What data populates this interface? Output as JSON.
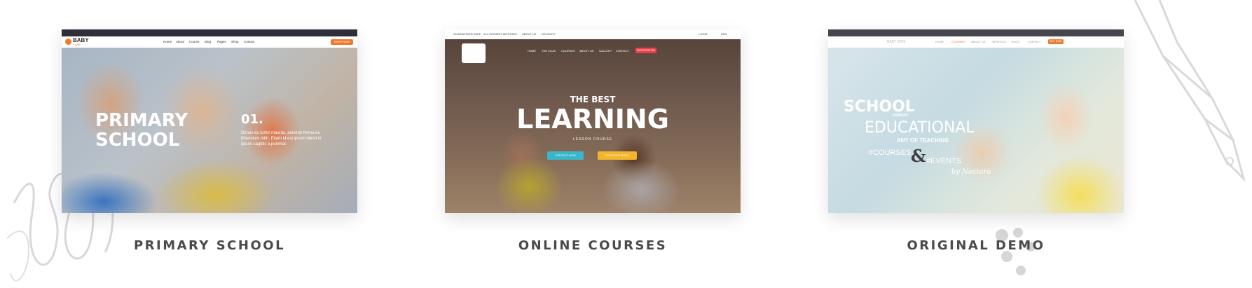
{
  "cards": [
    {
      "caption": "PRIMARY SCHOOL",
      "site": {
        "logo_line1": "BABY",
        "logo_line2": "CARE",
        "nav": [
          "Home",
          "About",
          "Course",
          "Blog",
          "Pages",
          "Shop",
          "Contact"
        ],
        "nav_button": "SHOP NOW",
        "hero_title_line1": "PRIMARY",
        "hero_title_line2": "SCHOOL",
        "hero_number": "01.",
        "hero_text": "Donec eu tortor maurus, pulvinar fermo eu bibendum nibh. Etiam id est ipsum blend in ipsum sagittis a pulvinar."
      }
    },
    {
      "caption": "ONLINE COURSES",
      "site": {
        "top_links": [
          "GUARANTEED SAFE",
          "ALL PAYMENT METHODS",
          "ABOUT US",
          "DELIVERY"
        ],
        "top_right": [
          "LOGIN",
          "ENG"
        ],
        "nav": [
          "HOME",
          "THE CLUB",
          "COURSES",
          "ABOUT US",
          "GALLERY",
          "CONTACT"
        ],
        "nav_button": "REGISTRATION",
        "hero_kicker": "THE BEST",
        "hero_title": "LEARNING",
        "hero_sub": "LESSON COURSE",
        "btn_primary": "CONTACT NOW",
        "btn_secondary": "DISCOVER MORE"
      }
    },
    {
      "caption": "ORIGINAL DEMO",
      "site": {
        "logo": "BABY KIDS",
        "nav": [
          "HOME",
          "COURSES",
          "ABOUT US",
          "SERVICES",
          "BLOG",
          "CONTACT"
        ],
        "nav_button": "BUY NOW",
        "hero_line1": "SCHOOL",
        "hero_line1_sub": "PRIMARY",
        "hero_line2": "EDUCATIONAL",
        "hero_line3": "ANY OF TEACHING",
        "hero_tag1": "#COURSES",
        "hero_amp": "&",
        "hero_tag2": "#EVENTS",
        "hero_sign": "by Nectaro"
      }
    }
  ],
  "colors": {
    "caption": "#4a4a4a",
    "accent_orange": "#f07a2b",
    "accent_red": "#e8414a",
    "accent_teal": "#3ab5c9",
    "accent_yellow": "#f3b52b"
  }
}
